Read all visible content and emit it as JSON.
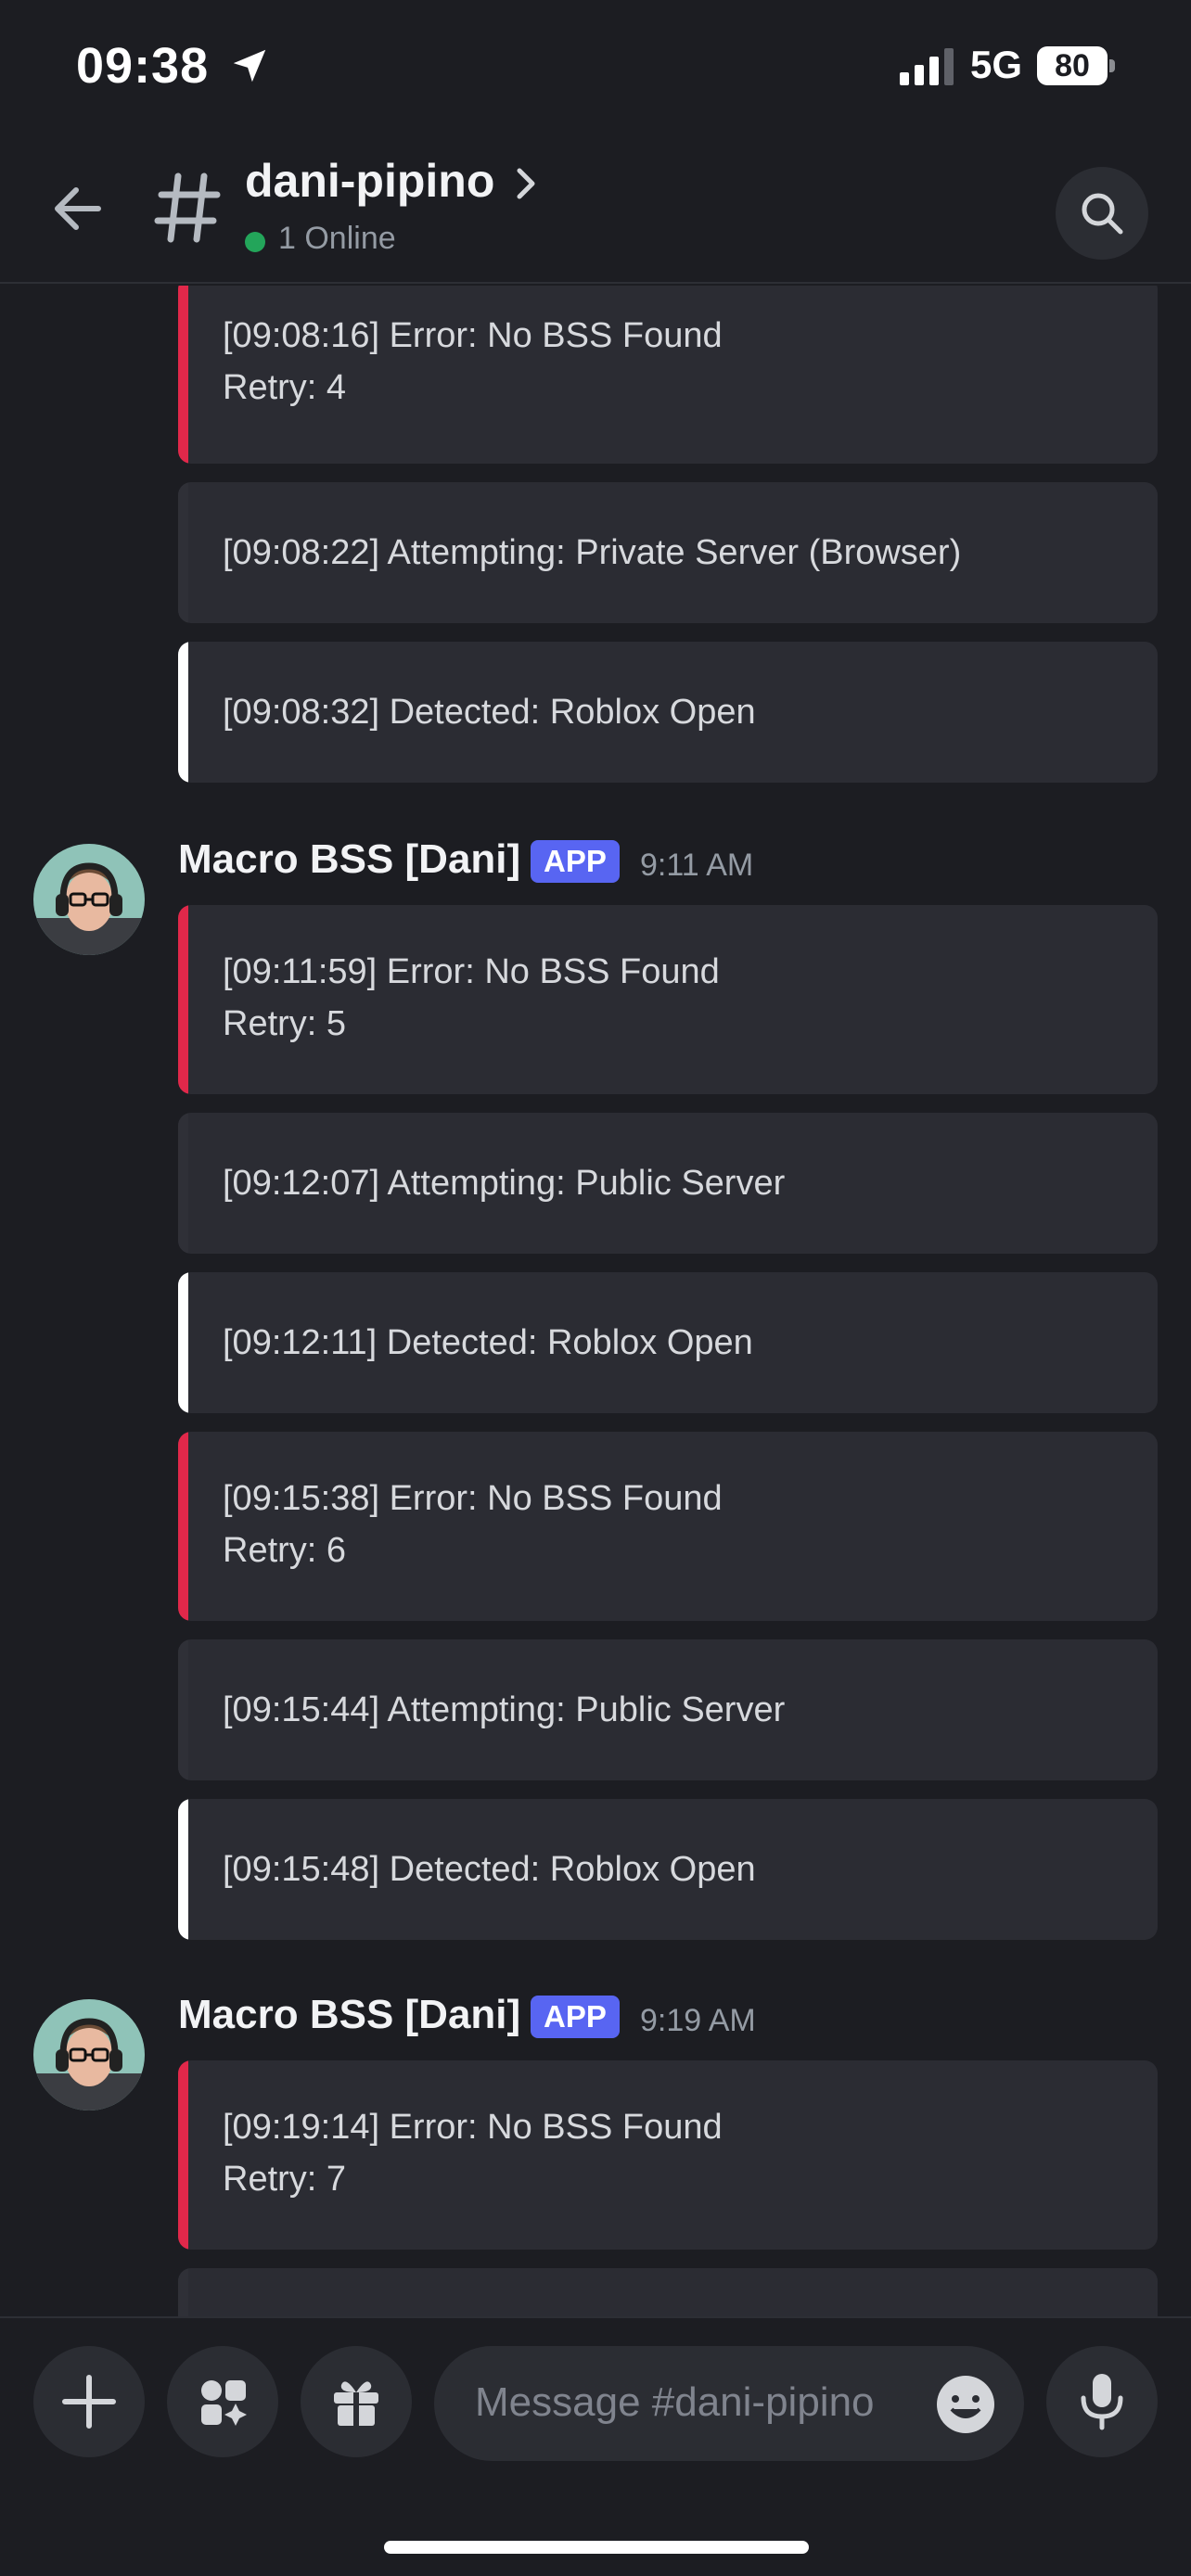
{
  "status_bar": {
    "time": "09:38",
    "network": "5G",
    "battery": "80"
  },
  "header": {
    "channel": "dani-pipino",
    "online": "1 Online"
  },
  "colors": {
    "error": "#e0284a",
    "info": "#2b2c33",
    "success": "#ffffff",
    "badge": "#5865f2",
    "online": "#23a55a"
  },
  "embeds_top": [
    {
      "lines": [
        "[09:08:16] Error: No BSS Found",
        "Retry: 4"
      ],
      "status": "error"
    },
    {
      "lines": [
        "[09:08:22] Attempting: Private Server (Browser)"
      ],
      "status": "info"
    },
    {
      "lines": [
        "[09:08:32] Detected: Roblox Open"
      ],
      "status": "success"
    }
  ],
  "messages": [
    {
      "author": "Macro BSS [Dani]",
      "badge": "APP",
      "time": "9:11 AM",
      "embeds": [
        {
          "lines": [
            "[09:11:59] Error: No BSS Found",
            "Retry: 5"
          ],
          "status": "error"
        },
        {
          "lines": [
            "[09:12:07] Attempting: Public Server"
          ],
          "status": "info"
        },
        {
          "lines": [
            "[09:12:11] Detected: Roblox Open"
          ],
          "status": "success"
        },
        {
          "lines": [
            "[09:15:38] Error: No BSS Found",
            "Retry: 6"
          ],
          "status": "error"
        },
        {
          "lines": [
            "[09:15:44] Attempting: Public Server"
          ],
          "status": "info"
        },
        {
          "lines": [
            "[09:15:48] Detected: Roblox Open"
          ],
          "status": "success"
        }
      ]
    },
    {
      "author": "Macro BSS [Dani]",
      "badge": "APP",
      "time": "9:19 AM",
      "embeds": [
        {
          "lines": [
            "[09:19:14] Error: No BSS Found",
            "Retry: 7"
          ],
          "status": "error"
        }
      ]
    }
  ],
  "composer": {
    "placeholder": "Message #dani-pipino"
  }
}
